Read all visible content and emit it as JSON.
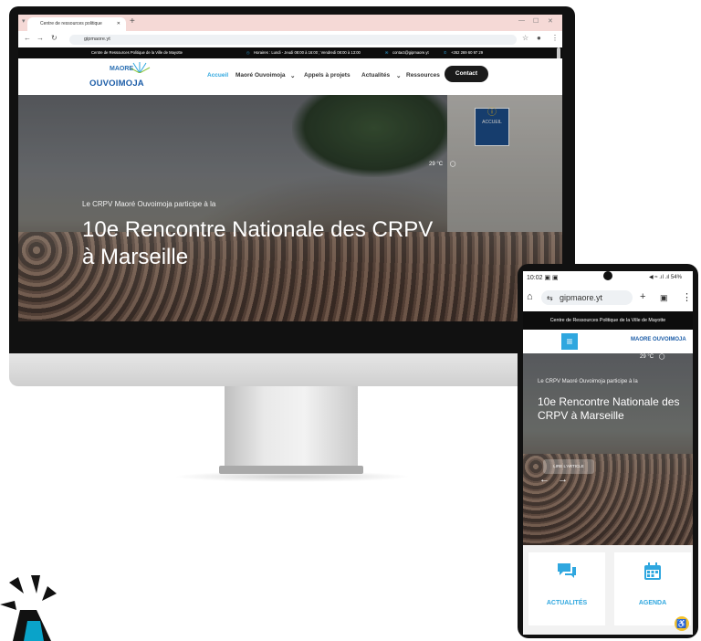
{
  "desktop": {
    "browser": {
      "tab_title": "Centre de ressources politique",
      "url": "gipmaore.yt"
    },
    "site": {
      "topbar": {
        "title": "Centre de Ressources Politique de la Ville de Mayotte",
        "hours": "Horaires : Lundi - Jeudi 08:00 à 16:00 ; Vendredi 08:00 à 13:00",
        "email": "contact@gipmaore.yt",
        "phone": "+262 269 60 97 29"
      },
      "logo": {
        "line1": "MAORE",
        "line2": "OUVOIMOJA"
      },
      "nav": [
        "Accueil",
        "Maoré Ouvoimoja",
        "Appels à projets",
        "Actualités",
        "Ressources"
      ],
      "contact_label": "Contact",
      "hero": {
        "kicker": "Le CRPV Maoré Ouvoimoja participe à la",
        "title": "10e Rencontre Nationale des CRPV à Marseille",
        "temperature": "29 °C",
        "sign": "ACCUEIL"
      }
    }
  },
  "mobile": {
    "status": {
      "time": "10:02",
      "battery": "54%"
    },
    "url": "gipmaore.yt",
    "topbar": "Centre de Ressources Politique de la Ville de Mayotte",
    "logo": "MAORE OUVOIMOJA",
    "hero": {
      "kicker": "Le CRPV Maoré Ouvoimoja participe à la",
      "title": "10e Rencontre Nationale des CRPV à Marseille",
      "temperature": "29 °C",
      "readmore": "LIRE L'ARTICLE"
    },
    "cards": [
      {
        "label": "ACTUALITÉS",
        "icon": "chat-bubbles-icon"
      },
      {
        "label": "AGENDA",
        "icon": "calendar-icon"
      }
    ]
  },
  "colors": {
    "accent": "#2fa7df",
    "brand": "#1c5da8",
    "dark": "#1a1a1a",
    "tabbar": "#f5d9d6"
  }
}
